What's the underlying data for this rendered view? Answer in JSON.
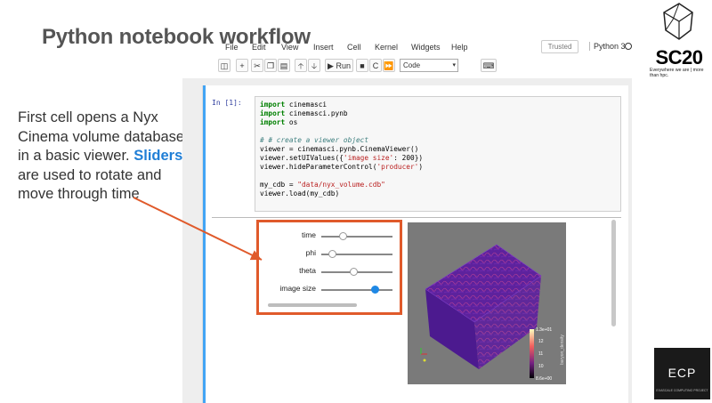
{
  "slide": {
    "title": "Python notebook workflow",
    "caption_pre": "First cell opens a Nyx Cinema volume database in a basic viewer.  ",
    "caption_highlight": "Sliders",
    "caption_post": " are used to rotate and move through time"
  },
  "menubar": {
    "items": [
      "File",
      "Edit",
      "View",
      "Insert",
      "Cell",
      "Kernel",
      "Widgets",
      "Help"
    ],
    "trusted": "Trusted",
    "kernel": "Python 3"
  },
  "toolbar": {
    "run_label": "▶ Run",
    "cell_type": "Code"
  },
  "cell": {
    "prompt": "In [1]:",
    "lines": [
      "import cinemasci",
      "import cinemasci.pynb",
      "import os",
      "",
      "# # create a viewer object",
      "viewer = cinemasci.pynb.CinemaViewer()",
      "viewer.setUIValues({'image size': 200})",
      "viewer.hideParameterControl('producer')",
      "",
      "my_cdb = \"data/nyx_volume.cdb\"",
      "viewer.load(my_cdb)"
    ]
  },
  "sliders": [
    {
      "label": "time",
      "value": 0.3
    },
    {
      "label": "phi",
      "value": 0.15
    },
    {
      "label": "theta",
      "value": 0.45
    },
    {
      "label": "image size",
      "value": 0.75
    }
  ],
  "colorbar": {
    "max_label": "1.3e+01",
    "ticks": [
      "12",
      "11",
      "10"
    ],
    "min_label": "8.6e+00",
    "title": "baryon_density"
  },
  "logos": {
    "sc20": "SC20",
    "sc20_tagline": "Everywhere we are | more than hpc.",
    "ecp": "ECP",
    "ecp_sub": "EXASCALE COMPUTING PROJECT"
  },
  "colors": {
    "accent_blue": "#1f7ed6",
    "highlight_border": "#e05a2b",
    "cell_bar": "#42a5f5"
  }
}
